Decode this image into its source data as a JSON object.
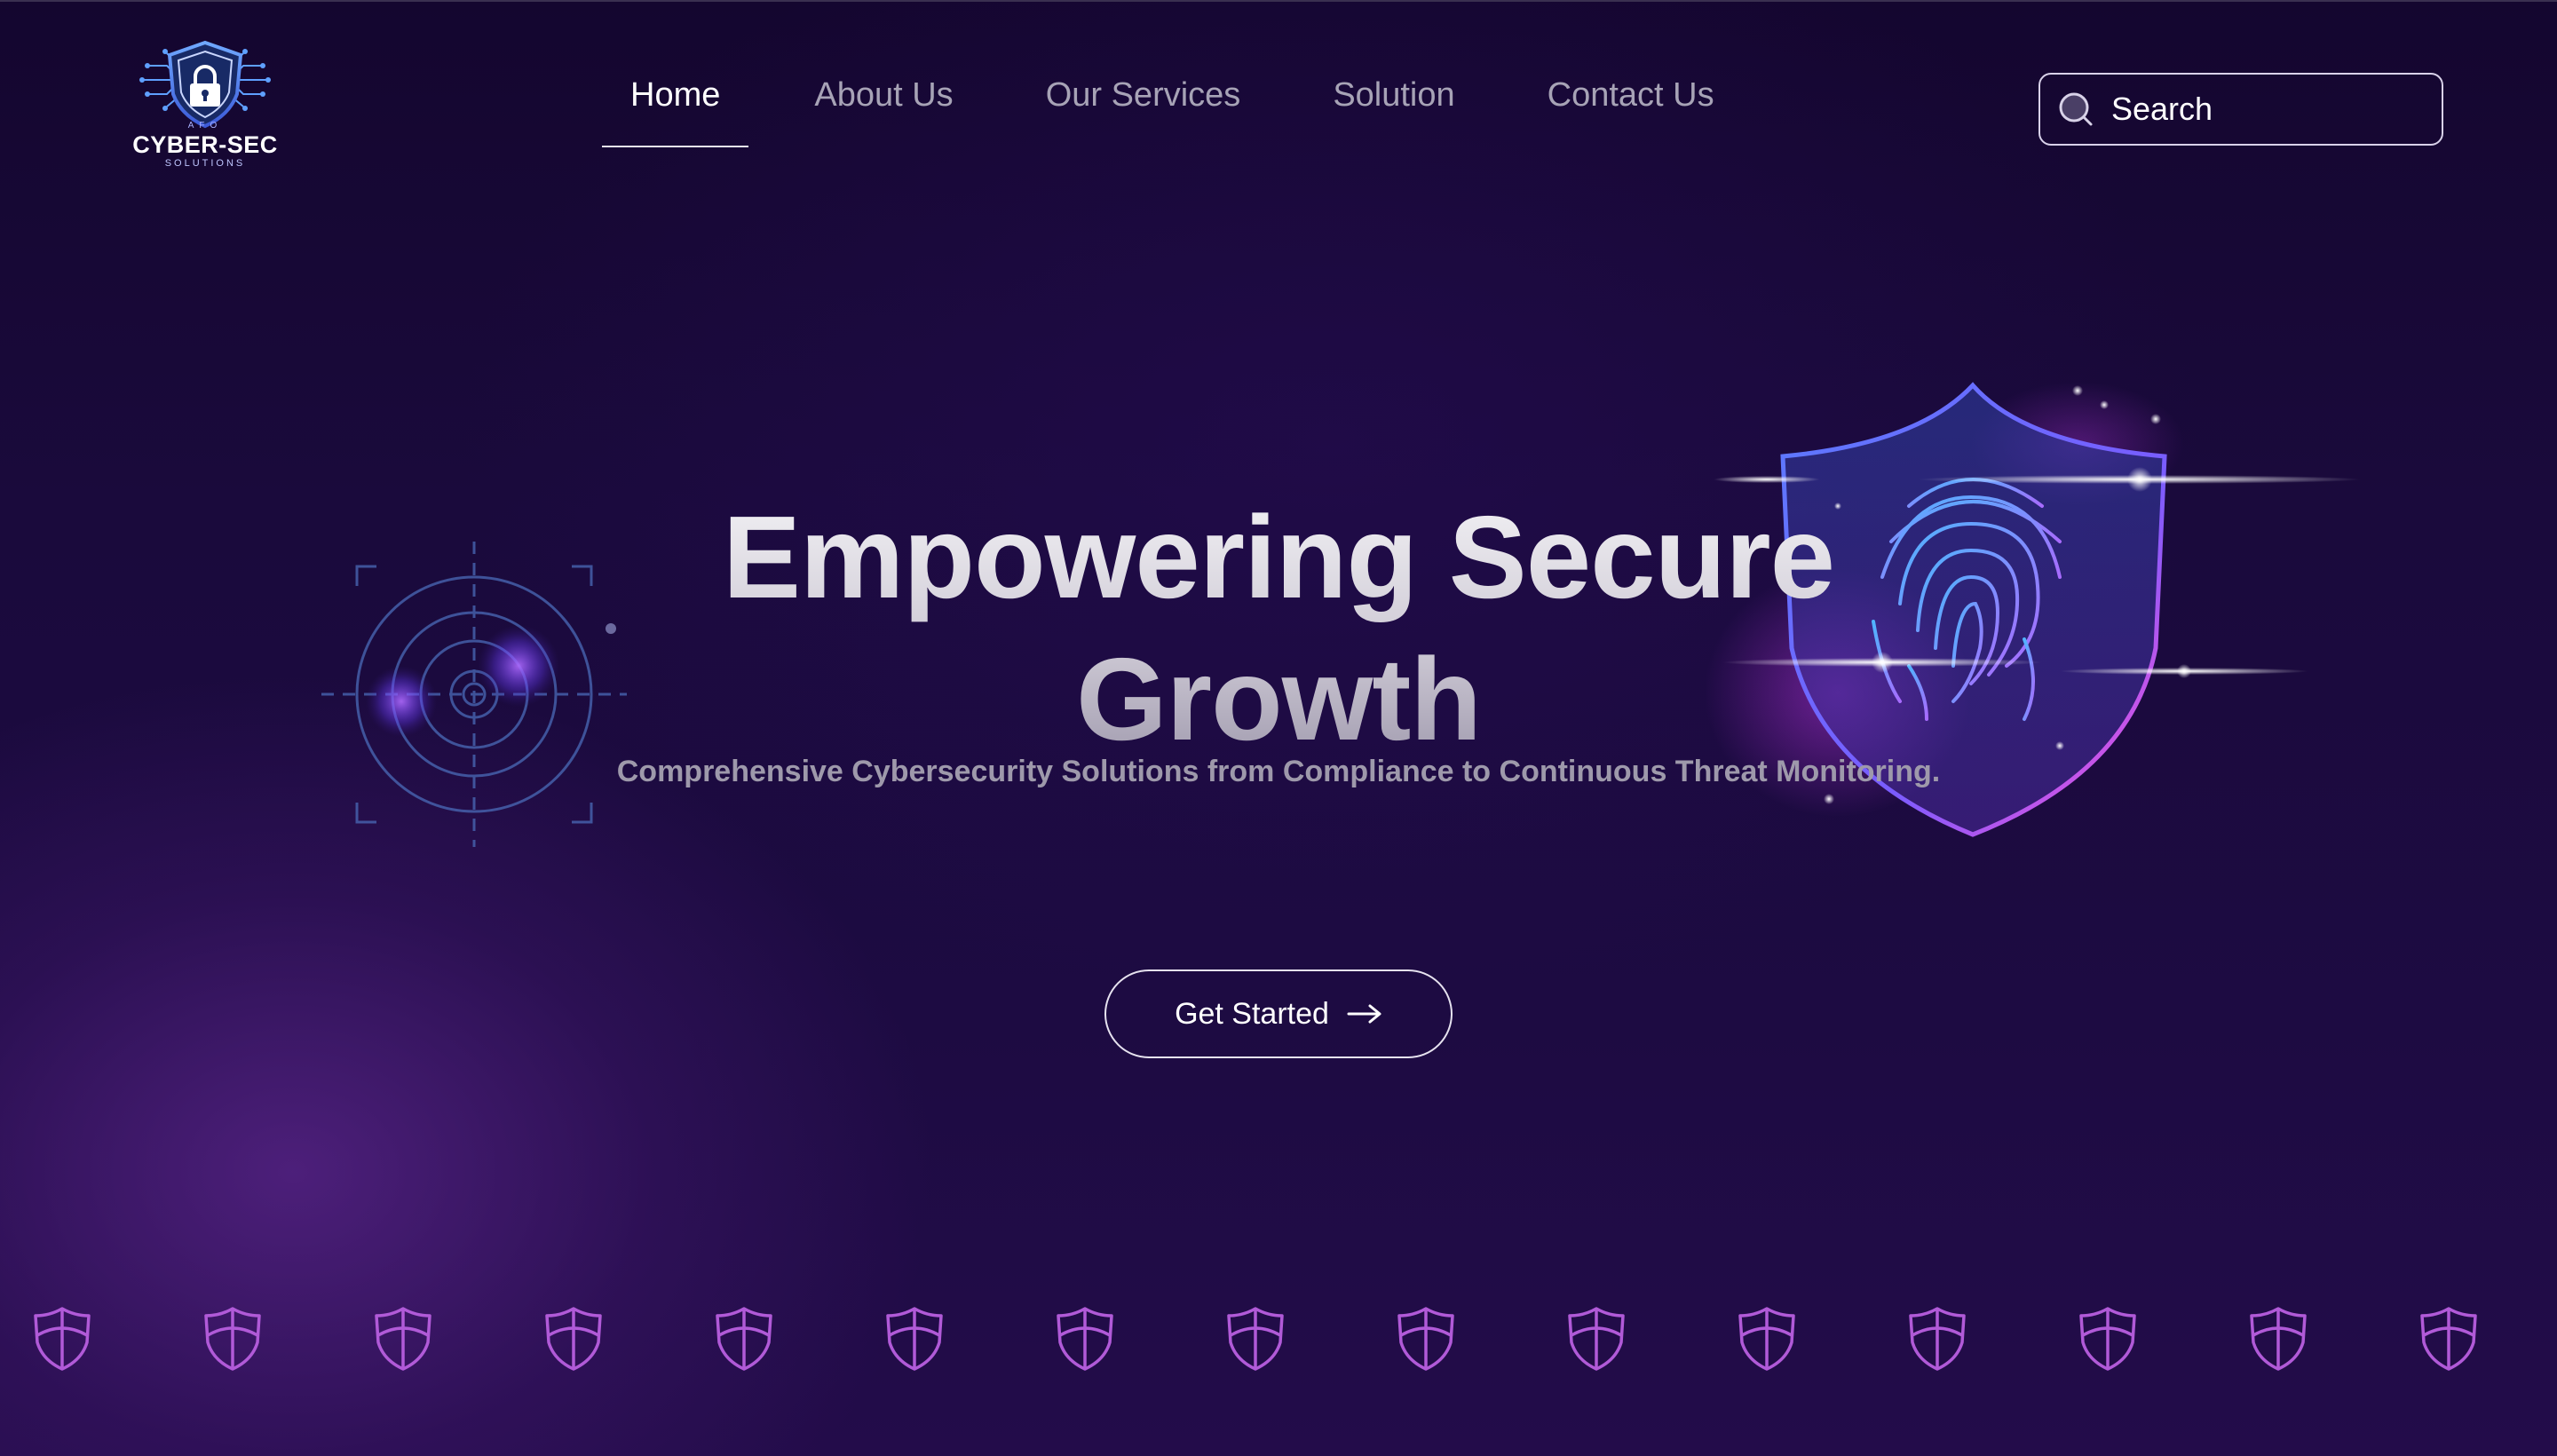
{
  "brand": {
    "name": "CYBER-SEC",
    "sub": "SOLUTIONS",
    "prefix": "AFO"
  },
  "nav": {
    "items": [
      {
        "label": "Home",
        "active": true
      },
      {
        "label": "About Us",
        "active": false
      },
      {
        "label": "Our Services",
        "active": false
      },
      {
        "label": "Solution",
        "active": false
      },
      {
        "label": "Contact Us",
        "active": false
      }
    ]
  },
  "search": {
    "placeholder": "Search",
    "icon": "search-icon"
  },
  "hero": {
    "title_line1": "Empowering Secure",
    "title_line2": "Growth",
    "subtitle": "Comprehensive Cybersecurity Solutions from Compliance to Continuous Threat Monitoring.",
    "cta_label": "Get Started",
    "cta_icon": "arrow-right-icon"
  },
  "decor": {
    "left_icon": "target-reticle-icon",
    "right_icon": "fingerprint-shield-icon",
    "row_icon": "shield-icon",
    "row_count": 15
  },
  "colors": {
    "background": "#1a0a3c",
    "accent": "#b44dff",
    "shield_row": "#b15ad8",
    "text_muted": "#a7a3b6"
  }
}
